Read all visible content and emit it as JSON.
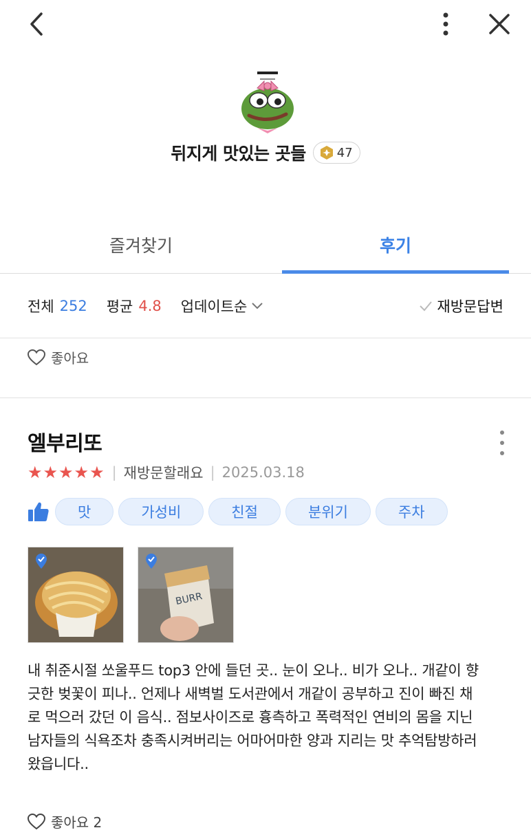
{
  "header": {
    "back_icon": "chevron-left-icon",
    "more_icon": "vertical-dots-icon",
    "close_icon": "close-icon"
  },
  "profile": {
    "title": "뒤지게 맛있는 곳들",
    "level": "47",
    "avatar": "frog-avatar-image"
  },
  "tabs": [
    {
      "label": "즐겨찾기",
      "active": false
    },
    {
      "label": "후기",
      "active": true
    }
  ],
  "filter": {
    "total_label": "전체",
    "total_value": "252",
    "avg_label": "평균",
    "avg_value": "4.8",
    "sort_label": "업데이트순",
    "revisit_answer_label": "재방문답변"
  },
  "prev_review": {
    "like_label": "좋아요"
  },
  "review": {
    "name": "엘부리또",
    "stars": "★★★★★",
    "revisit": "재방문할래요",
    "date": "2025.03.18",
    "tags": [
      "맛",
      "가성비",
      "친절",
      "분위기",
      "주차"
    ],
    "text": "내 취준시절 쏘울푸드 top3 안에 들던 곳..  눈이 오나.. 비가 오나.. 개같이 향긋한 벚꽃이 피나..  언제나 새벽벌 도서관에서 개같이 공부하고 진이 빠진 채로 먹으러 갔던 이 음식..  점보사이즈로 흉측하고 폭력적인 연비의 몸을 지닌 남자들의 식욕조차 충족시켜버리는 어마어마한 양과 지리는 맛  추억탐방하러 왔읍니다..",
    "like_label": "좋아요 2"
  },
  "colors": {
    "accent_blue": "#3b7de0",
    "star_red": "#e9554f",
    "tag_bg": "#e7f0fd"
  }
}
